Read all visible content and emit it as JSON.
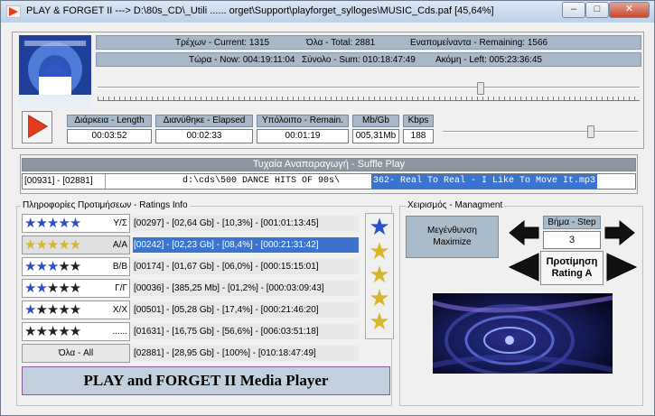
{
  "window": {
    "title": "PLAY & FORGET II ---> D:\\80s_CD\\_Utili ...... orget\\Support\\playforget_sylloges\\MUSIC_Cds.paf [45,64%]",
    "controls": {
      "minimize": "–",
      "maximize": "□",
      "close": "✕"
    }
  },
  "status": {
    "row1": {
      "current": "Τρέχων - Current: 1315",
      "total": "Όλα - Total: 2881",
      "remaining": "Εναπομείναντα - Remaining: 1566"
    },
    "row2": {
      "now": "Τώρα - Now:  004:19:11:04",
      "sum": "Σύνολο - Sum:  010:18:47:49",
      "left": "Ακόμη - Left:  005:23:36:45"
    }
  },
  "seek": {
    "position": 0.71
  },
  "volume": {
    "position": 0.77
  },
  "track": {
    "headers": {
      "length": "Διάρκεια - Length",
      "elapsed": "Διανύθηκε - Elapsed",
      "remain": "Υπόλοιπο - Remain.",
      "size": "Mb/Gb",
      "bitrate": "Kbps"
    },
    "values": {
      "length": "00:03:52",
      "elapsed": "00:02:33",
      "remain": "00:01:19",
      "size": "005,31Mb",
      "bitrate": "188"
    }
  },
  "shuffle": {
    "title": "Τυχαία Αναπαραγωγή - Suffle Play",
    "counter": "[00931] - [02881]",
    "path_plain": "d:\\cds\\500 DANCE HITS OF  90s\\",
    "path_selected": "362- Real To Real - I Like To Move It.mp3"
  },
  "ratings": {
    "title": "Πληροφορίες Προτιμήσεων - Ratings Info",
    "rows": [
      {
        "label": "Υ/Σ",
        "stars": "★★★★★",
        "stats": "[00297] - [02,64 Gb] - [10,3%] - [001:01:13:45]"
      },
      {
        "label": "Α/Α",
        "stars": "★★★★★",
        "stats": "[00242] - [02,23 Gb] - [08,4%] - [000:21:31:42]"
      },
      {
        "label": "Β/Β",
        "stars": "★★★★★",
        "stats": "[00174] - [01,67 Gb] - [06,0%] - [000:15:15:01]"
      },
      {
        "label": "Γ/Γ",
        "stars": "★★★★★",
        "stats": "[00036] - [385,25 Mb] - [01,2%] - [000:03:09:43]"
      },
      {
        "label": "Χ/Χ",
        "stars": "★★★★★",
        "stats": "[00501] - [05,28 Gb] - [17,4%] - [000:21:46:20]"
      },
      {
        "label": "......",
        "stars": "★★★★★",
        "stats": "[01631] - [16,75 Gb] - [56,6%] - [006:03:51:18]"
      }
    ],
    "all_label": "Όλα - All",
    "all_stats": "[02881] - [28,95 Gb] - [100%] - [010:18:47:49]",
    "app_name": "PLAY and FORGET II Media Player"
  },
  "manage": {
    "title": "Χειρισμός - Managment",
    "maximize_line1": "Μεγένθυνση",
    "maximize_line2": "Maximize",
    "step_label": "Βήμα - Step",
    "step_value": "3",
    "pref_line1": "Προτίμηση",
    "pref_line2": "Rating A"
  },
  "colors": {
    "accent_blue": "#3a74cf",
    "star_blue": "#2a4fc8",
    "star_gold": "#d8b52a",
    "star_dark": "#222222",
    "play_red": "#e63b1e",
    "info_strip": "#a8b8c8"
  }
}
